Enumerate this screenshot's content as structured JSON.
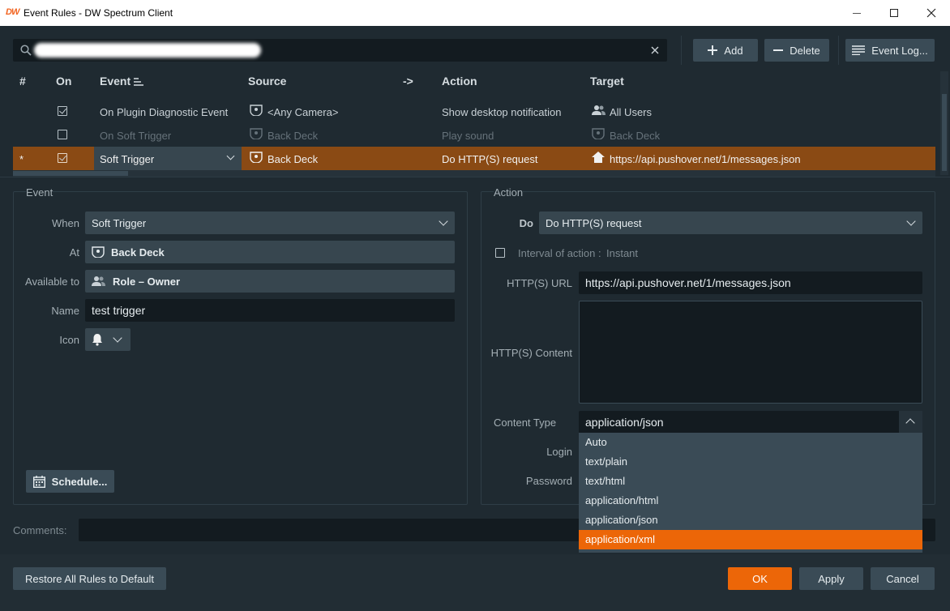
{
  "window": {
    "logo": "DW",
    "title": "Event Rules - DW Spectrum Client"
  },
  "toolbar": {
    "add_label": "Add",
    "delete_label": "Delete",
    "event_log_label": "Event Log..."
  },
  "table": {
    "headers": {
      "num": "#",
      "on": "On",
      "event": "Event",
      "source": "Source",
      "arrow": "->",
      "action": "Action",
      "target": "Target"
    },
    "rows": [
      {
        "marker": "",
        "on": true,
        "event": "On Plugin Diagnostic Event",
        "source": "<Any Camera>",
        "action": "Show desktop notification",
        "target": "All Users"
      },
      {
        "marker": "",
        "on": false,
        "event": "On Soft Trigger",
        "source": "Back Deck",
        "action": "Play sound",
        "target": "Back Deck"
      },
      {
        "marker": "*",
        "on": true,
        "event": "Soft Trigger",
        "source": "Back Deck",
        "action": "Do HTTP(S) request",
        "target": "https://api.pushover.net/1/messages.json"
      }
    ]
  },
  "event_panel": {
    "title": "Event",
    "when_label": "When",
    "when_value": "Soft Trigger",
    "at_label": "At",
    "at_value": "Back Deck",
    "available_label": "Available to",
    "available_value": "Role – Owner",
    "name_label": "Name",
    "name_value": "test trigger",
    "icon_label": "Icon",
    "schedule_label": "Schedule..."
  },
  "action_panel": {
    "title": "Action",
    "do_label": "Do",
    "do_value": "Do HTTP(S) request",
    "interval_label": "Interval of action :",
    "interval_value": "Instant",
    "url_label": "HTTP(S) URL",
    "url_value": "https://api.pushover.net/1/messages.json",
    "content_label": "HTTP(S) Content",
    "content_type_label": "Content Type",
    "content_type_value": "application/json",
    "login_label": "Login",
    "password_label": "Password",
    "content_type_options": [
      "Auto",
      "text/plain",
      "text/html",
      "application/html",
      "application/json",
      "application/xml"
    ],
    "highlighted_option": "application/xml"
  },
  "comments_label": "Comments:",
  "footer": {
    "restore_label": "Restore All Rules to Default",
    "ok_label": "OK",
    "apply_label": "Apply",
    "cancel_label": "Cancel"
  },
  "colors": {
    "accent": "#ec6608",
    "selected_row": "#8a4a14",
    "window_bg": "#1f2a31"
  }
}
